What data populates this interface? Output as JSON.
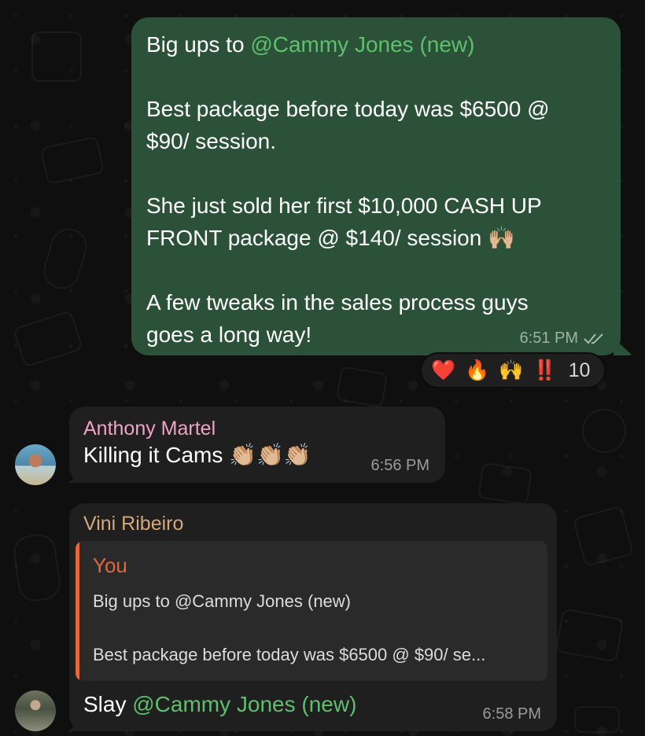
{
  "messages": {
    "outgoing": {
      "line1_prefix": "Big ups to ",
      "mention": "@Cammy Jones (new)",
      "paragraph2": "Best package before today was $6500 @\n$90/ session.",
      "paragraph3": "She just sold her first $10,000 CASH UP\nFRONT package @ $140/ session 🙌🏼",
      "paragraph4": "A few tweaks in the sales process guys\ngoes a long way!",
      "time": "6:51 PM",
      "read_receipt_icon": "double-check-icon",
      "reactions": [
        "❤️",
        "🔥",
        "🙌",
        "‼️"
      ],
      "reaction_count": "10"
    },
    "anthony": {
      "sender": "Anthony Martel",
      "sender_color": "#f2a3c4",
      "text": "Killing it Cams 👏🏼👏🏼👏🏼",
      "time": "6:56 PM"
    },
    "vini": {
      "sender": "Vini Ribeiro",
      "sender_color": "#d6a77a",
      "reply_author": "You",
      "reply_accent": "#e3673a",
      "reply_line1": "Big ups to @Cammy Jones (new)",
      "reply_line2": "Best package before today was $6500 @ $90/ se...",
      "text_prefix": "Slay ",
      "mention": "@Cammy Jones (new)",
      "time": "6:58 PM"
    }
  },
  "colors": {
    "outgoing_bubble": "#2b5238",
    "incoming_bubble": "#1f1f1f",
    "mention": "#5fbf6e",
    "background": "#0f0f0f"
  }
}
